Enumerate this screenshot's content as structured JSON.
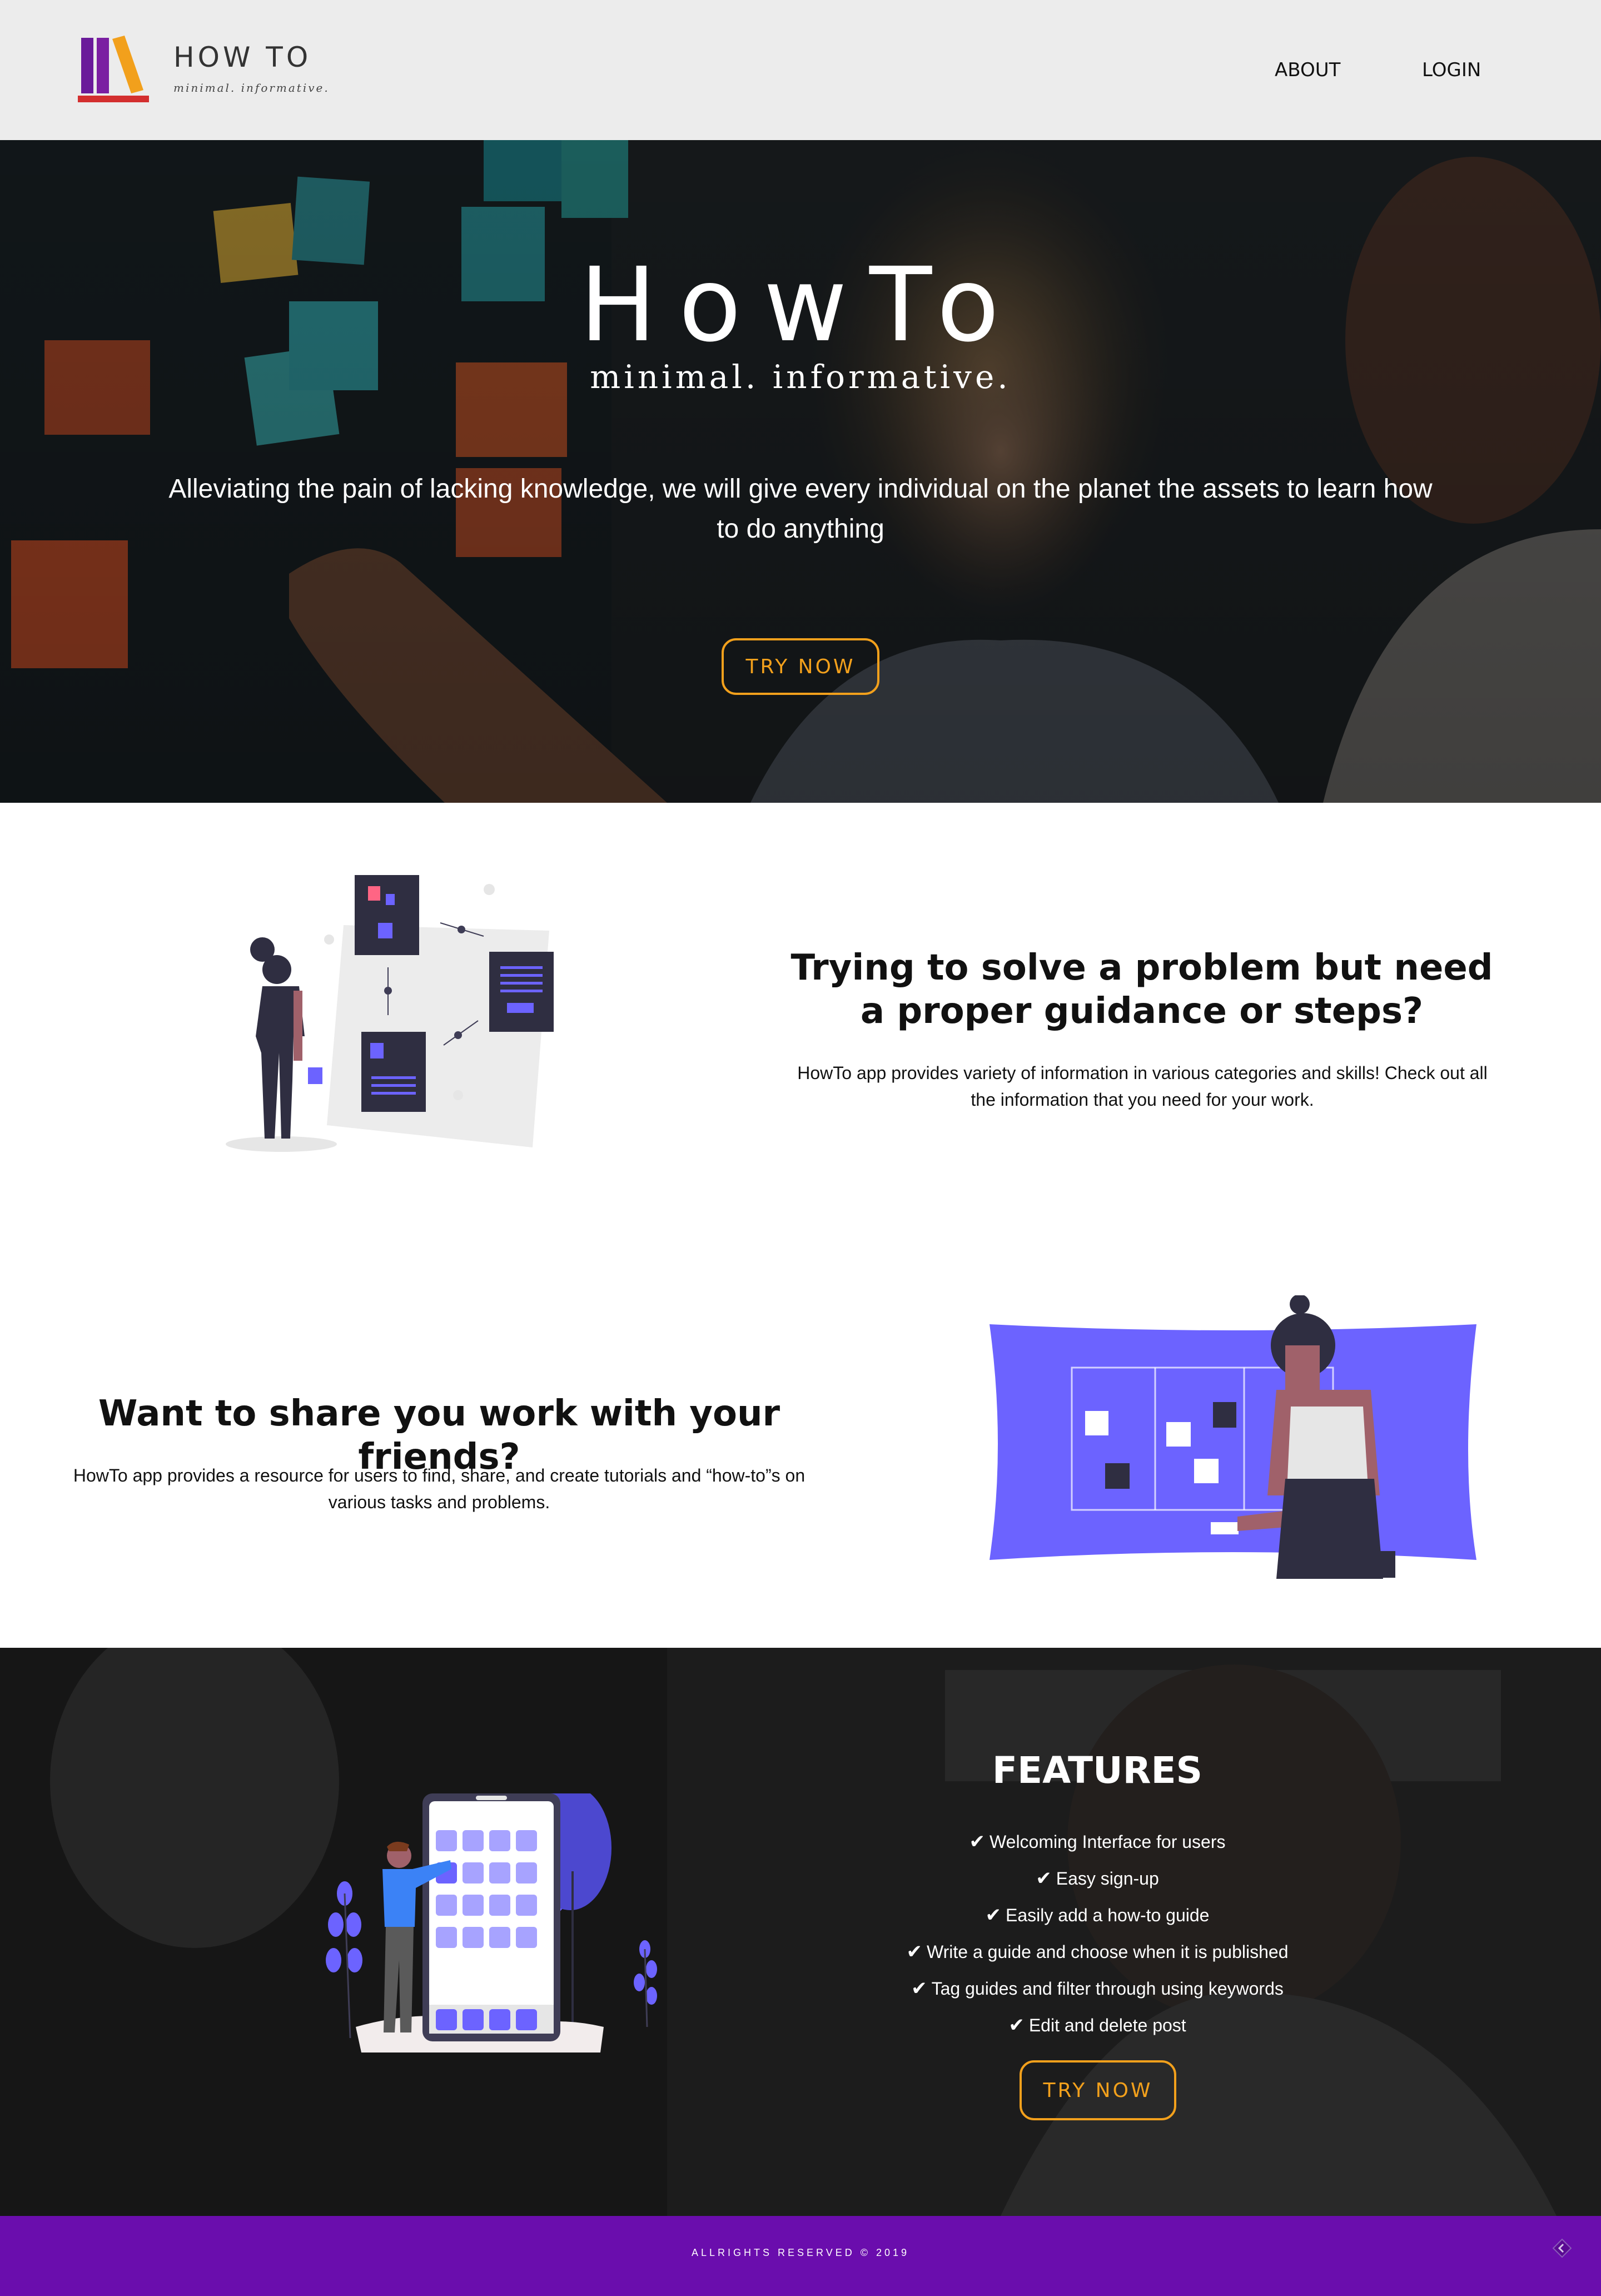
{
  "header": {
    "logo_title": "HOW TO",
    "logo_tagline": "minimal. informative.",
    "nav": [
      {
        "label": "ABOUT"
      },
      {
        "label": "LOGIN"
      }
    ]
  },
  "hero": {
    "title": "HowTo",
    "subtitle": "minimal. informative.",
    "description": "Alleviating the pain of lacking knowledge, we will give every individual on the planet the assets to learn how to do anything",
    "cta_label": "TRY NOW"
  },
  "section_one": {
    "heading": "Trying to solve a problem but need a proper guidance or steps?",
    "text": "HowTo app provides variety of information in various categories and skills! Check out all the information that you need for your work."
  },
  "section_two": {
    "heading": "Want to share you work with your friends?",
    "text": "HowTo app provides a resource for users to find, share, and create tutorials and “how-to”s on various tasks and problems."
  },
  "features": {
    "title": "FEATURES",
    "items": [
      "Welcoming Interface for users",
      "Easy sign-up",
      "Easily add a how-to guide",
      "Write a guide and choose when it is published",
      "Tag guides and filter through using keywords",
      "Edit and delete post"
    ],
    "cta_label": "TRY NOW"
  },
  "footer": {
    "text": "ALLRIGHTS RESERVED © 2019"
  },
  "colors": {
    "accent_orange": "#f2a01c",
    "illustration_purple": "#6c63ff",
    "footer_purple": "#6a0dad",
    "header_bg": "#ececec"
  },
  "icons": [
    "books-logo-icon",
    "check-icon",
    "scroll-top-icon"
  ]
}
